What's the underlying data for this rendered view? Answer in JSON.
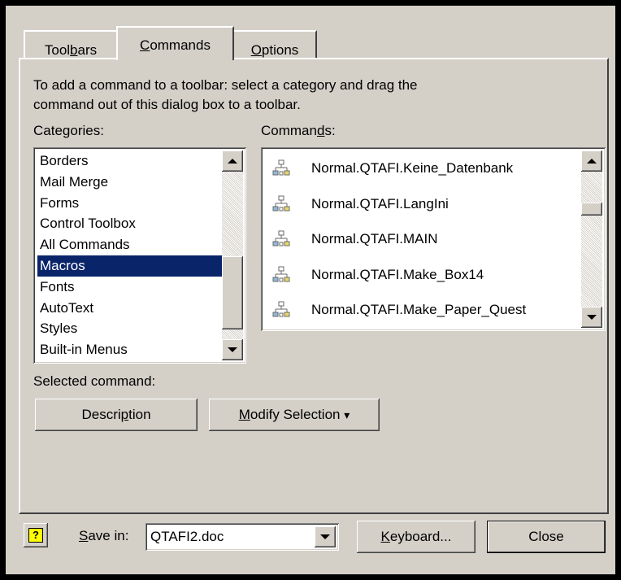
{
  "tabs": [
    {
      "pre": "Tool",
      "mn": "b",
      "post": "ars"
    },
    {
      "pre": "",
      "mn": "C",
      "post": "ommands"
    },
    {
      "pre": "",
      "mn": "O",
      "post": "ptions"
    }
  ],
  "instructions": {
    "line1": "To add a command to a toolbar: select a category and drag the",
    "line2": "command out of this dialog box to a toolbar."
  },
  "categories": {
    "label_pre": "Cate",
    "label_mn": "g",
    "label_post": "ories:",
    "items": [
      "Borders",
      "Mail Merge",
      "Forms",
      "Control Toolbox",
      "All Commands",
      "Macros",
      "Fonts",
      "AutoText",
      "Styles",
      "Built-in Menus"
    ],
    "selected": "Macros"
  },
  "commands": {
    "label_pre": "Comman",
    "label_mn": "d",
    "label_post": "s:",
    "items": [
      "Normal.QTAFI.Keine_Datenbank",
      "Normal.QTAFI.LangIni",
      "Normal.QTAFI.MAIN",
      "Normal.QTAFI.Make_Box14",
      "Normal.QTAFI.Make_Paper_Quest"
    ],
    "icon": "macro-icon"
  },
  "selected_command": {
    "label": "Selected command:",
    "description_pre": "Descri",
    "description_mn": "p",
    "description_post": "tion",
    "modify_pre": "",
    "modify_mn": "M",
    "modify_post": "odify Selection",
    "modify_arrow": "▾"
  },
  "footer": {
    "help_icon": "?",
    "save_in_pre": "",
    "save_in_mn": "S",
    "save_in_post": "ave in:",
    "save_in_value": "QTAFI2.doc",
    "keyboard_pre": "",
    "keyboard_mn": "K",
    "keyboard_post": "eyboard...",
    "close": "Close"
  },
  "colors": {
    "face": "#d4d0c8",
    "selection": "#0a246a",
    "help_icon": "#ffff00"
  }
}
